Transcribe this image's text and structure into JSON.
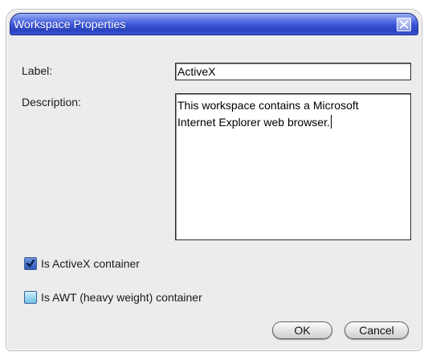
{
  "window": {
    "title": "Workspace Properties"
  },
  "form": {
    "label_caption": "Label:",
    "label_value": "ActiveX",
    "description_caption": "Description:",
    "description_value": "This workspace contains a Microsoft\nInternet Explorer web browser."
  },
  "options": {
    "activex_label": "Is ActiveX container",
    "activex_checked": true,
    "awt_label": "Is AWT (heavy weight) container",
    "awt_checked": false
  },
  "buttons": {
    "ok_label": "OK",
    "cancel_label": "Cancel"
  },
  "icons": {
    "close": "close-icon",
    "check": "checkmark-icon"
  },
  "colors": {
    "title_bar": "#3b55d6",
    "dialog_bg": "#ececec"
  }
}
